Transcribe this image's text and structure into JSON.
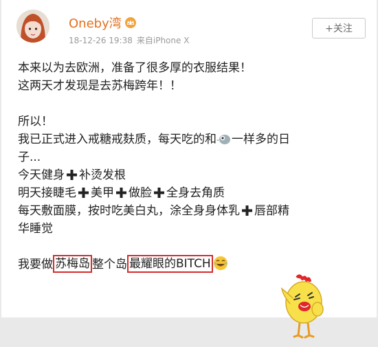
{
  "post": {
    "username": "Oneby湾",
    "timestamp": "18-12-26 19:38",
    "source": "来自iPhone X",
    "follow_button": "+关注",
    "lines": {
      "l1": "本来以为去欧洲，准备了很多厚的衣服结果！",
      "l2": "这两天才发现是去苏梅跨年！！",
      "l3": "所以！",
      "l4a": "我已正式进入戒糖戒麸质，每天吃的和",
      "l4b": "一样多的日",
      "l5": "子...",
      "l6a": "今天健身",
      "l6b": "补烫发根",
      "l7a": "明天接睫毛",
      "l7b": "美甲",
      "l7c": "做脸",
      "l7d": "全身去角质",
      "l8a": "每天敷面膜，按时吃美白丸，涂全身身体乳",
      "l8b": "唇部精",
      "l9": "华睡觉",
      "l10a": "我要做",
      "l10b": "苏梅岛",
      "l10c": "整个岛",
      "l10d": "最耀眼的BITCH"
    }
  },
  "icons": {
    "badge": "crown-badge-icon",
    "plus": "heavy-plus-icon",
    "bird": "bird-emoji-icon",
    "laugh": "laughing-emoji-icon",
    "sticker": "chick-sticker-icon"
  },
  "colors": {
    "username": "#e3701f",
    "highlight_box": "#d42b2b",
    "meta_text": "#9a9a9a"
  }
}
